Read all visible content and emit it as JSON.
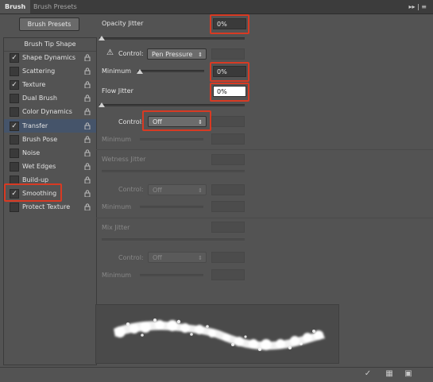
{
  "tabs": [
    "Brush",
    "Brush Presets"
  ],
  "panel_controls": "▸▸ | ≡",
  "left": {
    "presets_button": "Brush Presets",
    "tip_shape": "Brush Tip Shape",
    "items": [
      {
        "label": "Shape Dynamics",
        "checked": true,
        "selected": false
      },
      {
        "label": "Scattering",
        "checked": false,
        "selected": false
      },
      {
        "label": "Texture",
        "checked": true,
        "selected": false
      },
      {
        "label": "Dual Brush",
        "checked": false,
        "selected": false
      },
      {
        "label": "Color Dynamics",
        "checked": false,
        "selected": false
      },
      {
        "label": "Transfer",
        "checked": true,
        "selected": true
      },
      {
        "label": "Brush Pose",
        "checked": false,
        "selected": false
      },
      {
        "label": "Noise",
        "checked": false,
        "selected": false
      },
      {
        "label": "Wet Edges",
        "checked": false,
        "selected": false
      },
      {
        "label": "Build-up",
        "checked": false,
        "selected": false
      },
      {
        "label": "Smoothing",
        "checked": true,
        "selected": false
      },
      {
        "label": "Protect Texture",
        "checked": false,
        "selected": false
      }
    ]
  },
  "transfer": {
    "opacity_jitter_label": "Opacity Jitter",
    "opacity_jitter_value": "0%",
    "control_label": "Control:",
    "opacity_control": "Pen Pressure",
    "minimum_label": "Minimum",
    "opacity_minimum_value": "0%",
    "flow_jitter_label": "Flow Jitter",
    "flow_jitter_value": "0%",
    "flow_control": "Off",
    "flow_minimum_label": "Minimum",
    "wetness_jitter_label": "Wetness Jitter",
    "wetness_control_label": "Control:",
    "wetness_control": "Off",
    "wetness_minimum_label": "Minimum",
    "mix_jitter_label": "Mix Jitter",
    "mix_control_label": "Control:",
    "mix_control": "Off",
    "mix_minimum_label": "Minimum"
  },
  "highlight_color": "#d83a23",
  "selection_color": "#45546a",
  "bottom_icons": [
    "eye-stroke-icon",
    "grid-icon",
    "new-preset-icon"
  ]
}
